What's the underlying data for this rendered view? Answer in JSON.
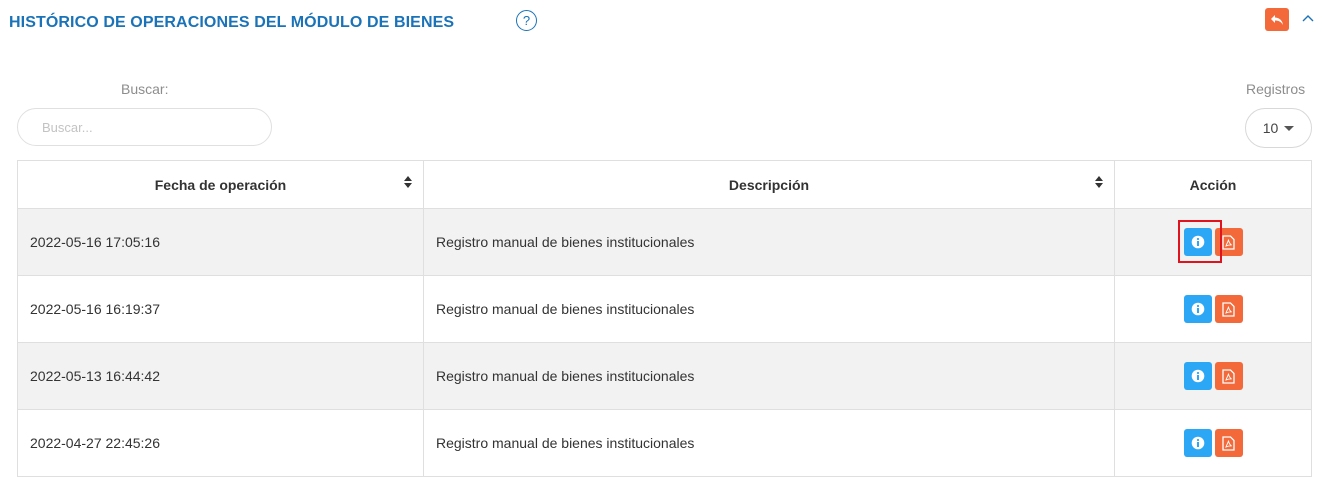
{
  "header": {
    "title": "HISTÓRICO DE OPERACIONES DEL MÓDULO DE BIENES",
    "help_icon": "help-circle-icon",
    "help_glyph": "?",
    "back_icon": "reply-icon",
    "collapse_icon": "chevron-up-icon"
  },
  "search": {
    "label": "Buscar:",
    "placeholder": "Buscar...",
    "value": ""
  },
  "registros": {
    "label": "Registros",
    "selected": "10"
  },
  "table": {
    "columns": [
      {
        "label": "Fecha de operación",
        "sortable": true
      },
      {
        "label": "Descripción",
        "sortable": true
      },
      {
        "label": "Acción",
        "sortable": false
      }
    ],
    "rows": [
      {
        "fecha": "2022-05-16 17:05:16",
        "descripcion": "Registro manual de bienes institucionales"
      },
      {
        "fecha": "2022-05-16 16:19:37",
        "descripcion": "Registro manual de bienes institucionales"
      },
      {
        "fecha": "2022-05-13 16:44:42",
        "descripcion": "Registro manual de bienes institucionales"
      },
      {
        "fecha": "2022-04-27 22:45:26",
        "descripcion": "Registro manual de bienes institucionales"
      }
    ],
    "action_icons": [
      "info-icon",
      "pdf-icon"
    ]
  },
  "colors": {
    "title": "#1a73b8",
    "info_button": "#2ba7f5",
    "pdf_button": "#f4693a",
    "row_striped": "#f2f2f2",
    "highlight": "#e0141e"
  }
}
